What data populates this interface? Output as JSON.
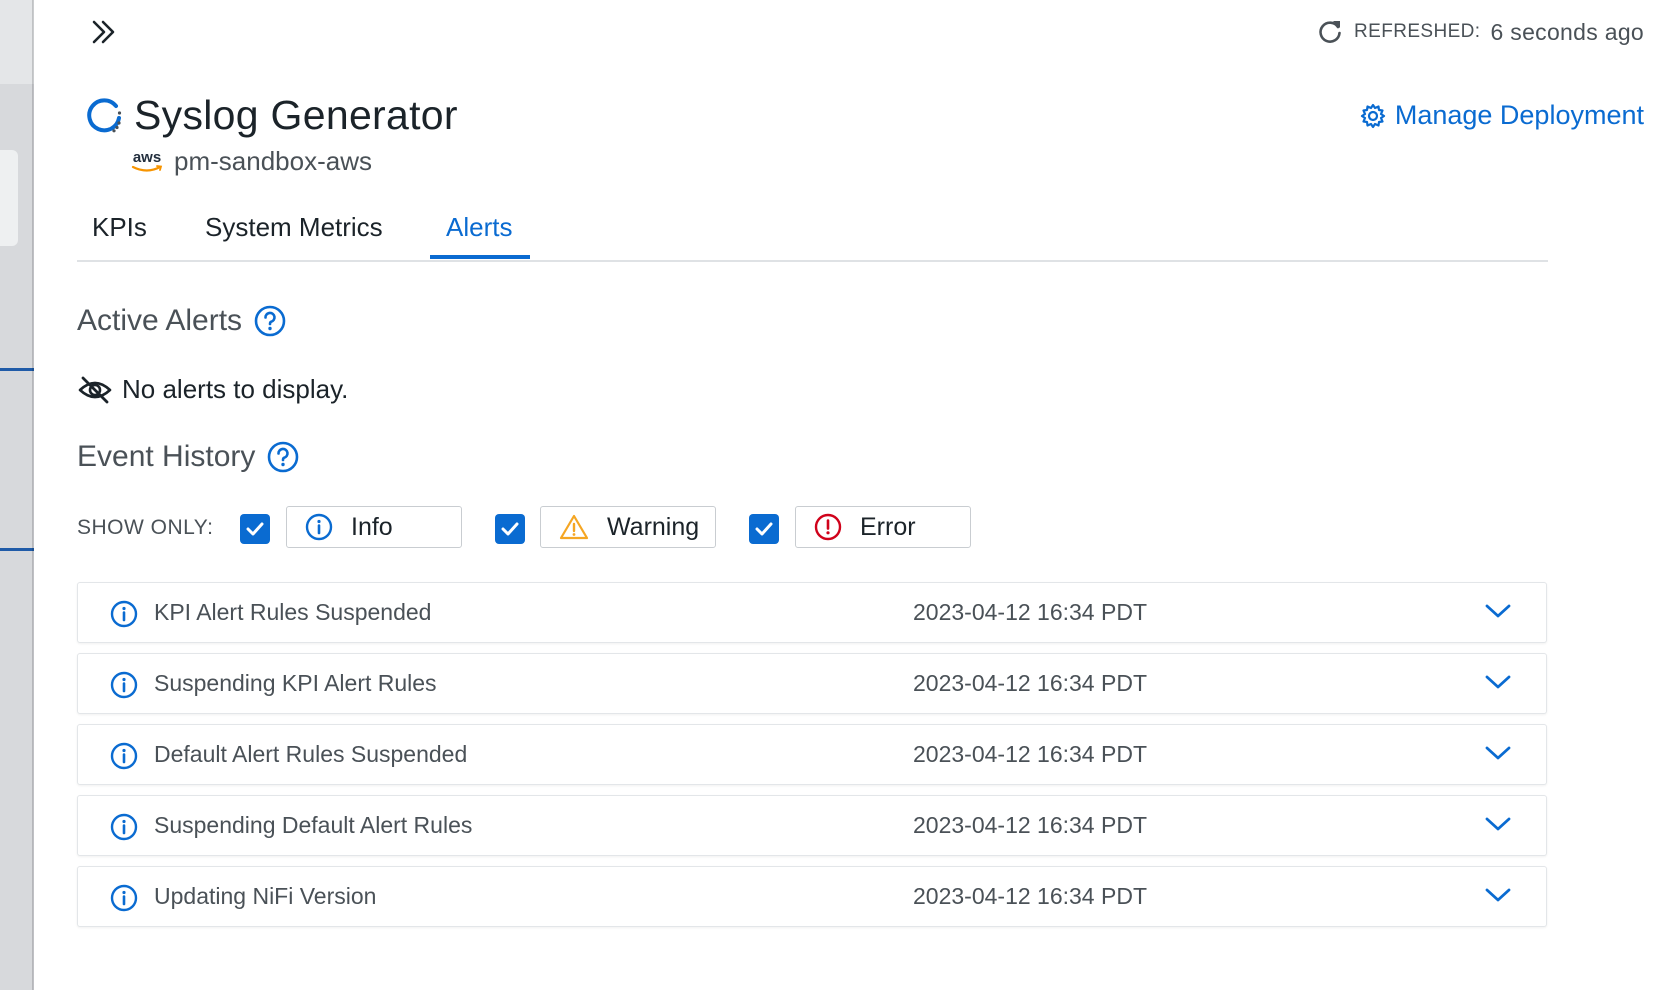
{
  "header": {
    "refreshed_label": "REFRESHED:",
    "refreshed_value": "6 seconds ago",
    "title": "Syslog Generator",
    "aws_logo_text": "aws",
    "subtitle": "pm-sandbox-aws",
    "manage_label": "Manage Deployment"
  },
  "tabs": [
    {
      "label": "KPIs",
      "active": false
    },
    {
      "label": "System Metrics",
      "active": false
    },
    {
      "label": "Alerts",
      "active": true
    }
  ],
  "active_alerts": {
    "title": "Active Alerts",
    "empty_message": "No alerts to display."
  },
  "event_history": {
    "title": "Event History",
    "show_only_label": "SHOW ONLY:",
    "filters": [
      {
        "label": "Info",
        "checked": true,
        "icon": "info-icon",
        "color": "#0a6bd1"
      },
      {
        "label": "Warning",
        "checked": true,
        "icon": "warning-icon",
        "color": "#f5a623"
      },
      {
        "label": "Error",
        "checked": true,
        "icon": "error-icon",
        "color": "#d0021b"
      }
    ],
    "events": [
      {
        "title": "KPI Alert Rules Suspended",
        "time": "2023-04-12 16:34 PDT",
        "icon": "info-icon"
      },
      {
        "title": "Suspending KPI Alert Rules",
        "time": "2023-04-12 16:34 PDT",
        "icon": "info-icon"
      },
      {
        "title": "Default Alert Rules Suspended",
        "time": "2023-04-12 16:34 PDT",
        "icon": "info-icon"
      },
      {
        "title": "Suspending Default Alert Rules",
        "time": "2023-04-12 16:34 PDT",
        "icon": "info-icon"
      },
      {
        "title": "Updating NiFi Version",
        "time": "2023-04-12 16:34 PDT",
        "icon": "info-icon"
      }
    ]
  },
  "colors": {
    "accent": "#0a6bd1",
    "text": "#1b2329",
    "muted_text": "#4a5157",
    "warning": "#f5a623",
    "error": "#d0021b"
  }
}
